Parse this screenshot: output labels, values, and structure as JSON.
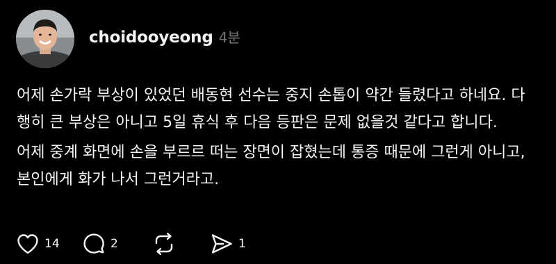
{
  "post": {
    "username": "choidooyeong",
    "timestamp": "4분",
    "paragraphs": [
      "어제 손가락 부상이 있었던 배동현 선수는 중지 손톱이 약간 들렸다고 하네요. 다행히 큰 부상은 아니고 5일 휴식 후 다음 등판은 문제 없을것 같다고 합니다.",
      "어제 중계 화면에 손을 부르르 떠는 장면이 잡혔는데 통증 때문에 그런게 아니고, 본인에게 화가 나서 그런거라고."
    ],
    "actions": {
      "like": {
        "icon": "heart-icon",
        "count": "14"
      },
      "reply": {
        "icon": "comment-icon",
        "count": "2"
      },
      "repost": {
        "icon": "repost-icon"
      },
      "share": {
        "icon": "send-icon",
        "count": "1"
      }
    }
  },
  "colors": {
    "background": "#000000",
    "text": "#f3f5f7",
    "muted": "#777777"
  }
}
